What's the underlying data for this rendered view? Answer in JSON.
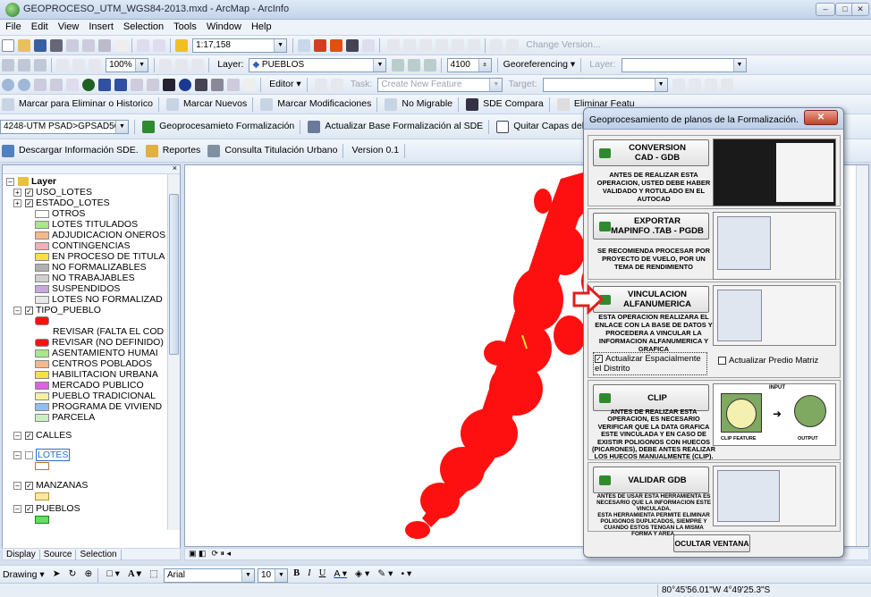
{
  "window": {
    "title": "GEOPROCESO_UTM_WGS84-2013.mxd - ArcMap - ArcInfo"
  },
  "menu": [
    "File",
    "Edit",
    "View",
    "Insert",
    "Selection",
    "Tools",
    "Window",
    "Help"
  ],
  "toolbar1": {
    "scale": "1:17,158",
    "change_version": "Change Version..."
  },
  "toolbar2": {
    "zoom": "100%",
    "layer_label": "Layer:",
    "layer_value": "PUEBLOS",
    "count": "4100",
    "georeferencing": "Georeferencing ▾",
    "layer2_label": "Layer:"
  },
  "toolbar3": {
    "editor": "Editor ▾",
    "task_label": "Task:",
    "task_value": "Create New Feature",
    "target_label": "Target:"
  },
  "toolbar4": [
    "Marcar para Eliminar o Historico",
    "Marcar Nuevos",
    "Marcar Modificaciones",
    "No Migrable",
    "SDE Compara",
    "Eliminar Featu"
  ],
  "toolbar5": {
    "projection": "4248-UTM PSAD>GPSAD56",
    "geoprocess": "Geoprocesamieto Formalización",
    "actualizar": "Actualizar Base Formalización al SDE",
    "quitar": "Quitar Capas del Mapa"
  },
  "toolbar6": {
    "descargar": "Descargar Información SDE.",
    "reportes": "Reportes",
    "consulta": "Consulta Titulación Urbano",
    "version": "Version 0.1"
  },
  "toc": {
    "tabs": [
      "Display",
      "Source",
      "Selection"
    ],
    "root": "Layer",
    "layers": [
      {
        "name": "USO_LOTES",
        "type": "group"
      },
      {
        "name": "ESTADO_LOTES",
        "type": "group"
      },
      {
        "name": "OTROS",
        "type": "class",
        "color": "#ffffff"
      },
      {
        "name": "LOTES TITULADOS",
        "type": "class",
        "color": "#a8e890"
      },
      {
        "name": "ADJUDICACION ONEROS",
        "type": "class",
        "color": "#f4b98a"
      },
      {
        "name": "CONTINGENCIAS",
        "type": "class",
        "color": "#f0b0b8"
      },
      {
        "name": "EN PROCESO DE TITULA",
        "type": "class",
        "color": "#f8e040"
      },
      {
        "name": "NO FORMALIZABLES",
        "type": "class",
        "color": "#b0b0b0"
      },
      {
        "name": "NO TRABAJABLES",
        "type": "class",
        "color": "#d0d0d0"
      },
      {
        "name": "SUSPENDIDOS",
        "type": "class",
        "color": "#c8a8e0"
      },
      {
        "name": "LOTES NO FORMALIZAD",
        "type": "class",
        "color": "#e8e8e8"
      },
      {
        "name": "TIPO_PUEBLO",
        "type": "group"
      },
      {
        "name": "",
        "type": "redbox"
      },
      {
        "name": "REVISAR (FALTA EL COD",
        "type": "plain"
      },
      {
        "name": "REVISAR (NO DEFINIDO)",
        "type": "redclass"
      },
      {
        "name": "ASENTAMIENTO HUMAI",
        "type": "class",
        "color": "#a8e890"
      },
      {
        "name": "CENTROS POBLADOS",
        "type": "class",
        "color": "#f4b98a"
      },
      {
        "name": "HABILITACION URBANA",
        "type": "class",
        "color": "#f8e040"
      },
      {
        "name": "MERCADO PUBLICO",
        "type": "class",
        "color": "#e060e0"
      },
      {
        "name": "PUEBLO TRADICIONAL",
        "type": "class",
        "color": "#f8f0a0"
      },
      {
        "name": "PROGRAMA DE VIVIEND",
        "type": "class",
        "color": "#90c0f0"
      },
      {
        "name": "PARCELA",
        "type": "class",
        "color": "#c8f0c0"
      },
      {
        "name": "CALLES",
        "type": "group"
      },
      {
        "name": "LOTES",
        "type": "selected"
      },
      {
        "name": "MANZANAS",
        "type": "group2"
      },
      {
        "name": "PUEBLOS",
        "type": "group3"
      }
    ]
  },
  "dialog": {
    "title": "Geoprocesamiento de planos de la  Formalización.",
    "close": "✕",
    "panels": [
      {
        "button": "CONVERSION\nCAD - GDB",
        "text": "ANTES DE REALIZAR ESTA\nOPERACION,  USTED DEBE HABER\nVALIDADO Y ROTULADO EN EL\nAUTOCAD"
      },
      {
        "button": "EXPORTAR\nMAPINFO .TAB - PGDB",
        "text": "SE RECOMIENDA PROCESAR POR\nPROYECTO DE VUELO, POR UN\nTEMA DE RENDIMIENTO"
      },
      {
        "button": "VINCULACION\nALFANUMERICA",
        "text": "ESTA OPERACION REALIZARA EL\nENLACE CON LA BASE DE DATOS Y\nPROCEDERA A VINCULAR LA\nINFORMACION ALFANUMERICA Y\nGRAFICA",
        "check1": "Actualizar Espacialmente el Distrito",
        "check2": "Actualizar Predio Matriz"
      },
      {
        "button": "CLIP",
        "text": "ANTES DE REALIZAR ESTA\nOPERACION,  ES NECESARIO\nVERIFICAR QUE LA DATA GRAFICA\nESTE VINCULADA Y EN CASO DE\nEXISTIR POLIGONOS CON HUECOS\n(PICARONES), DEBE ANTES REALIZAR\nLOS HUECOS MANUALMENTE (CLIP).",
        "clip_input": "INPUT",
        "clip_feature": "CLIP FEATURE",
        "clip_output": "OUTPUT"
      },
      {
        "button": "VALIDAR GDB",
        "text": "ANTES DE USAR ESTA HERRAMIENTA ES\nNECESARIO QUE LA INFORMACION ESTE\nVINCULADA.\nESTA HERRAMIENTA PERMITE ELIMINAR\nPOLIGONOS DUPLICADOS, SIEMPRE Y\nCUANDO ESTOS TENGAN LA MISMA\nFORMA Y AREA."
      }
    ],
    "hide_button": "OCULTAR VENTANA"
  },
  "drawing": {
    "label": "Drawing ▾",
    "font": "Arial",
    "size": "10"
  },
  "status": {
    "coords": "80°45'56.01\"W  4°49'25.3\"S"
  }
}
